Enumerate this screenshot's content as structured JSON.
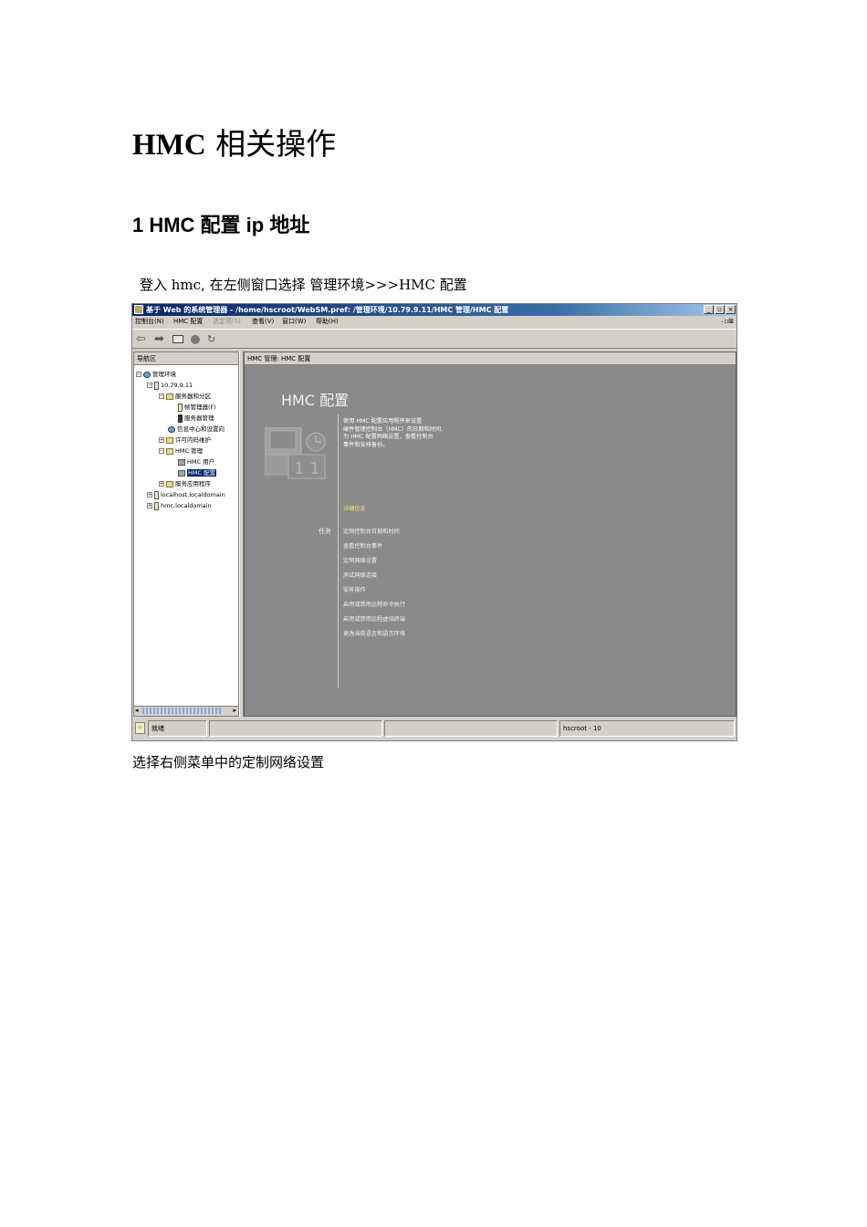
{
  "doc": {
    "title_latin": "HMC",
    "title_rest": " 相关操作",
    "section_heading": "1 HMC 配置 ip  地址",
    "intro_text": "登入 hmc,  在左侧窗口选择  管理环境>>>HMC 配置",
    "after_text": "选择右侧菜单中的定制网络设置"
  },
  "app": {
    "window_title": "基于 Web 的系统管理器 - /home/hscroot/WebSM.pref: /管理环境/10.79.9.11/HMC 管理/HMC 配置",
    "window_buttons": [
      "_",
      "▫",
      "×"
    ],
    "menus": [
      {
        "label": "控制台(N)",
        "enabled": true
      },
      {
        "label": "HMC 配置",
        "enabled": true
      },
      {
        "label": "选定项(S)",
        "enabled": false
      },
      {
        "label": "查看(V)",
        "enabled": true
      },
      {
        "label": "窗口(W)",
        "enabled": true
      },
      {
        "label": "帮助(H)",
        "enabled": true
      }
    ],
    "mdi_controls": "₋▫⊠",
    "navigation_header": "导航区",
    "tree": [
      {
        "label": "管理环境",
        "indent": 0,
        "icon": "globe",
        "expander": "−"
      },
      {
        "label": "10.79.9.11",
        "indent": 1,
        "icon": "server",
        "expander": "−"
      },
      {
        "label": "服务器和分区",
        "indent": 2,
        "icon": "folder",
        "expander": "−"
      },
      {
        "label": "帧管理器(F)",
        "indent": 3,
        "icon": "server",
        "expander": ""
      },
      {
        "label": "服务器管理",
        "indent": 3,
        "icon": "dark",
        "expander": ""
      },
      {
        "label": "信息中心和设置向",
        "indent": 2,
        "icon": "globe",
        "expander": ""
      },
      {
        "label": "许可内码维护",
        "indent": 2,
        "icon": "folder",
        "expander": "+"
      },
      {
        "label": "HMC 管理",
        "indent": 2,
        "icon": "folder",
        "expander": "−"
      },
      {
        "label": "HMC 用户",
        "indent": 3,
        "icon": "hmc",
        "expander": ""
      },
      {
        "label": "HMC 配置",
        "indent": 3,
        "icon": "hmc",
        "expander": "",
        "selected": true
      },
      {
        "label": "服务应用程序",
        "indent": 2,
        "icon": "folder",
        "expander": "+"
      },
      {
        "label": "localhost.localdomain",
        "indent": 1,
        "icon": "server",
        "expander": "+"
      },
      {
        "label": "hmc.localdomain",
        "indent": 1,
        "icon": "server",
        "expander": "+"
      }
    ],
    "content_breadcrumb": "HMC 管理: HMC 配置",
    "content_title": "HMC 配置",
    "description_lines": [
      "使用 HMC 配置应用程序来设置",
      "硬件管理控制台（HMC）的日期和时间,",
      "为 HMC 配置网络设置，查看控制台",
      "事件和安排备份。"
    ],
    "detail_link": "详细信息",
    "tasks_label": "任务",
    "tasks": [
      "定制控制台日期和时间",
      "查看控制台事件",
      "定制网络设置",
      "测试网络连接",
      "安排操作",
      "启用或禁用远程命令执行",
      "启用或禁用远程虚拟终端",
      "更改当前语言和语言环境"
    ],
    "status": {
      "ready": "就绪",
      "user": "hscroot - 10"
    }
  }
}
